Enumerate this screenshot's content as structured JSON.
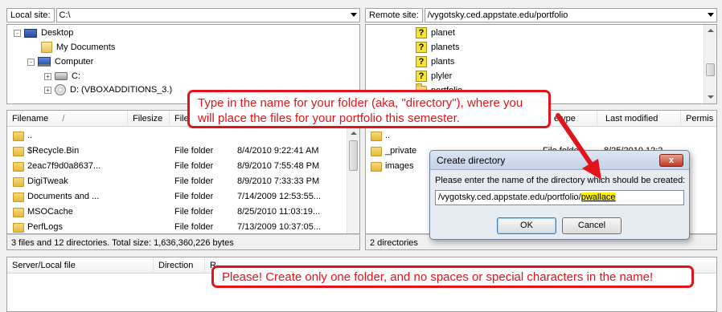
{
  "local_site": {
    "label": "Local site:",
    "path": "C:\\"
  },
  "remote_site": {
    "label": "Remote site:",
    "path": "/vygotsky.ced.appstate.edu/portfolio"
  },
  "local_tree": [
    {
      "label": "Desktop",
      "icon": "desktop-icon",
      "expander": "-"
    },
    {
      "label": "My Documents",
      "icon": "folder-icon",
      "expander": ""
    },
    {
      "label": "Computer",
      "icon": "computer-icon",
      "expander": "-"
    },
    {
      "label": "C:",
      "icon": "drive-icon",
      "expander": "+"
    },
    {
      "label": "D: (VBOXADDITIONS_3.)",
      "icon": "cd-drive-icon",
      "expander": "+"
    }
  ],
  "remote_tree": [
    {
      "label": "planet",
      "icon": "unknown-folder-icon"
    },
    {
      "label": "planets",
      "icon": "unknown-folder-icon"
    },
    {
      "label": "plants",
      "icon": "unknown-folder-icon"
    },
    {
      "label": "plyler",
      "icon": "unknown-folder-icon"
    },
    {
      "label": "portfolio",
      "icon": "folder-icon"
    }
  ],
  "local_list": {
    "columns": {
      "filename": "Filename",
      "sort_indicator": "/",
      "filesize": "Filesize",
      "filetype": "Filet"
    },
    "rows": [
      {
        "name": "..",
        "type": "",
        "modified": ""
      },
      {
        "name": "$Recycle.Bin",
        "type": "File folder",
        "modified": "8/4/2010 9:22:41 AM"
      },
      {
        "name": "2eac7f9d0a8637...",
        "type": "File folder",
        "modified": "8/9/2010 7:55:48 PM"
      },
      {
        "name": "DigiTweak",
        "type": "File folder",
        "modified": "8/9/2010 7:33:33 PM"
      },
      {
        "name": "Documents and ...",
        "type": "File folder",
        "modified": "7/14/2009 12:53:55..."
      },
      {
        "name": "MSOCache",
        "type": "File folder",
        "modified": "8/25/2010 11:03:19..."
      },
      {
        "name": "PerfLogs",
        "type": "File folder",
        "modified": "7/13/2009 10:37:05..."
      }
    ],
    "status": "3 files and 12 directories. Total size: 1,636,360,226 bytes"
  },
  "remote_list": {
    "columns": {
      "filetype": "etype",
      "last_modified": "Last modified",
      "permissions": "Permis"
    },
    "rows": [
      {
        "name": "..",
        "type": "",
        "modified": ""
      },
      {
        "name": "_private",
        "type": "File folder",
        "modified": "8/25/2010 12:2"
      },
      {
        "name": "images",
        "type": "",
        "modified": ""
      }
    ],
    "status": "2 directories"
  },
  "queue": {
    "columns": {
      "server_file": "Server/Local file",
      "direction": "Direction",
      "remote": "R"
    }
  },
  "dialog": {
    "title": "Create directory",
    "close": "x",
    "prompt": "Please enter the name of the directory which should be created:",
    "input_prefix": "/vygotsky.ced.appstate.edu/portfolio/",
    "input_highlight": "pwallace",
    "ok": "OK",
    "cancel": "Cancel"
  },
  "callouts": {
    "top": "Type in the name for your folder (aka, \"directory\"), where you will place the files for your portfolio this semester.",
    "bottom": "Please! Create only one folder, and no spaces or special characters in the name!"
  },
  "colors": {
    "callout_red": "#e0141a",
    "highlight_yellow": "#fff200"
  }
}
